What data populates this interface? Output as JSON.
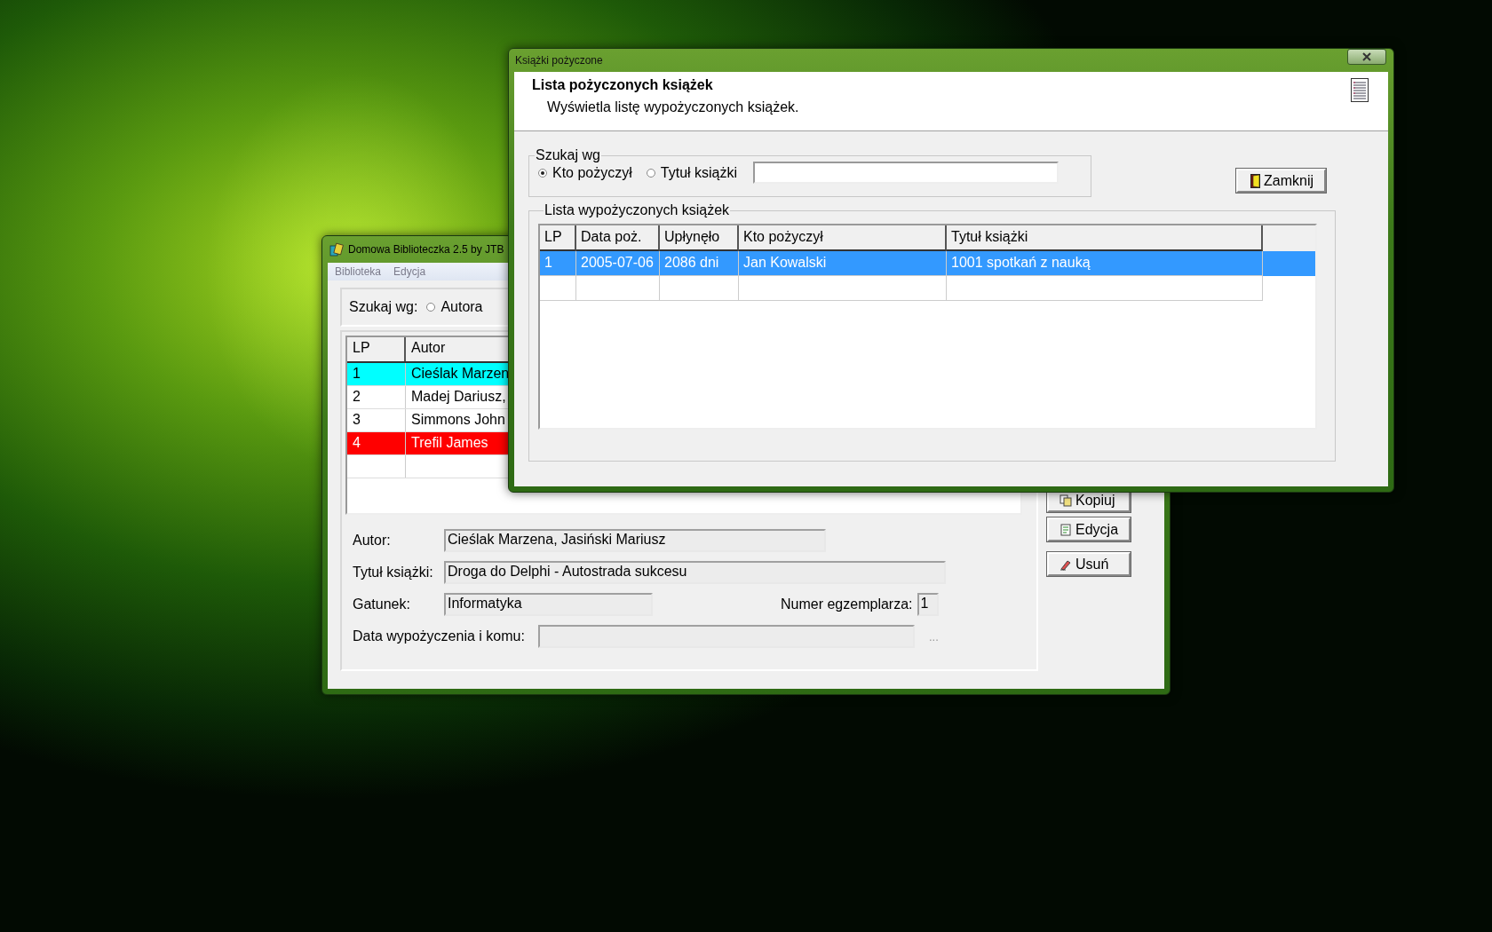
{
  "main_window": {
    "title": "Domowa Biblioteczka 2.5 by JTB",
    "menu": [
      "Biblioteka",
      "Edycja"
    ],
    "search": {
      "label": "Szukaj wg:",
      "options": [
        {
          "label": "Autora",
          "selected": false
        }
      ]
    },
    "table": {
      "columns": [
        "LP",
        "Autor"
      ],
      "rows": [
        {
          "cells": [
            "1",
            "Cieślak Marzen"
          ],
          "color": "#00ffff"
        },
        {
          "cells": [
            "2",
            "Madej Dariusz,"
          ]
        },
        {
          "cells": [
            "3",
            "Simmons John"
          ]
        },
        {
          "cells": [
            "4",
            "Trefil James"
          ],
          "color": "#ff0000"
        }
      ]
    },
    "details": {
      "author": {
        "label": "Autor:",
        "value": "Cieślak Marzena, Jasiński Mariusz"
      },
      "title": {
        "label": "Tytuł książki:",
        "value": "Droga do Delphi - Autostrada sukcesu"
      },
      "genre": {
        "label": "Gatunek:",
        "value": "Informatyka"
      },
      "copy_number": {
        "label": "Numer egzemplarza:",
        "value": "1"
      },
      "loan": {
        "label": "Data wypożyczenia i komu:",
        "button": "..."
      }
    },
    "buttons": [
      {
        "kind": "copy",
        "label": "Kopiuj"
      },
      {
        "kind": "edit",
        "label": "Edycja"
      },
      {
        "kind": "delete",
        "label": "Usuń"
      }
    ]
  },
  "dialog": {
    "title": "Książki pożyczone",
    "header": {
      "title": "Lista pożyczonych książek",
      "subtitle": "Wyświetla listę wypożyczonych książek."
    },
    "search": {
      "legend": "Szukaj wg",
      "options": [
        {
          "label": "Kto pożyczył",
          "selected": true
        },
        {
          "label": "Tytuł książki",
          "selected": false
        }
      ]
    },
    "close_button": "Zamknij",
    "list": {
      "legend": "Lista wypożyczonych książek",
      "columns": [
        "LP",
        "Data poż.",
        "Upłynęło",
        "Kto pożyczył",
        "Tytuł książki"
      ],
      "rows": [
        {
          "cells": [
            "1",
            "2005-07-06",
            "2086 dni",
            "Jan Kowalski",
            "1001 spotkań z nauką"
          ],
          "selected": true
        }
      ]
    }
  }
}
